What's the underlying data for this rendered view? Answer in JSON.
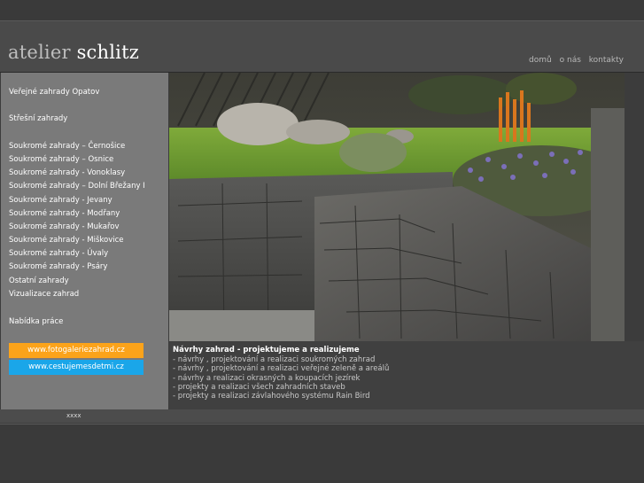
{
  "header": {
    "logo_light": "atelier",
    "logo_bold": "schlitz",
    "nav": [
      "domů",
      "o nás",
      "kontakty"
    ]
  },
  "sidebar": {
    "items": [
      "Veřejné zahrady Opatov",
      "Střešní zahrady",
      "Soukromé zahrady – Černošice",
      "Soukromé zahrady – Osnice",
      "Soukromé zahrady - Vonoklasy",
      "Soukromé zahrady – Dolní Břežany I",
      "Soukromé zahrady - Jevany",
      "Soukromé zahrady - Modřany",
      "Soukromé zahrady - Mukařov",
      "Soukromé zahrady - Miškovice",
      "Soukromé zahrady - Úvaly",
      "Soukromé zahrady - Psáry",
      "Ostatní zahrady",
      "Vizualizace zahrad",
      "Nabídka práce"
    ],
    "badges": [
      {
        "label": "www.fotogaleriezahrad.cz",
        "color": "#fba31a"
      },
      {
        "label": "www.cestujemesdetmi.cz",
        "color": "#1aa6e9"
      }
    ]
  },
  "content": {
    "title": "Návrhy zahrad - projektujeme a realizujeme",
    "lines": [
      "- návrhy , projektování a realizaci soukromých zahrad",
      "- návrhy , projektování a realizaci veřejné zeleně a areálů",
      "- návrhy a realizaci okrasných a koupacích jezírek",
      "- projekty a realizaci všech zahradních staveb",
      "- projekty a realizaci závlahového systému Rain Bird"
    ]
  },
  "footer": {
    "text": "xxxx"
  },
  "colors": {
    "accent_orange": "#fba31a",
    "accent_blue": "#1aa6e9",
    "sidebar_bg": "#7a7a7a"
  }
}
